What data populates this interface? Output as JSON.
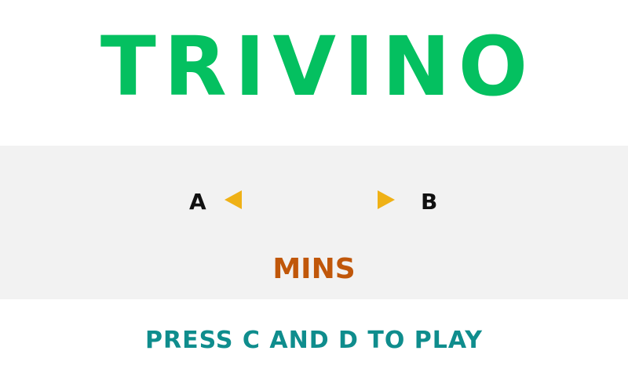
{
  "title": "TRIVINO",
  "selector": {
    "left_key": "A",
    "right_key": "B",
    "left_arrow_icon": "triangle-left-icon",
    "right_arrow_icon": "triangle-right-icon",
    "value": "",
    "unit": "MINS"
  },
  "prompt": "PRESS C AND D TO PLAY",
  "colors": {
    "title": "#04c060",
    "arrows": "#efb116",
    "unit": "#c0570a",
    "prompt": "#0f8d8d",
    "panel": "#f2f2f2"
  }
}
